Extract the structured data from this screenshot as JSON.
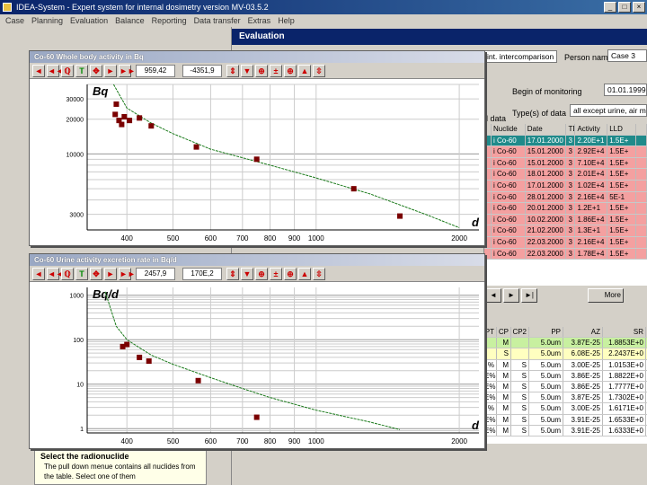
{
  "app": {
    "title": "IDEA-System - Expert system for internal dosimetry version MV-03.5.2",
    "menu": [
      "Case",
      "Planning",
      "Evaluation",
      "Balance",
      "Reporting",
      "Data transfer",
      "Extras",
      "Help"
    ]
  },
  "evaluation": {
    "header": "Evaluation",
    "field_top": "int. intercomparison",
    "person_label": "Person name",
    "person_value": "Case 3",
    "begin_label": "Begin of monitoring",
    "begin_value": "01.01.1999",
    "types_label": "Type(s) of data",
    "types_value": "all except urine, air monitoring",
    "data_label": "l data"
  },
  "measurements": {
    "headers": [
      "",
      "Nuclide",
      "Date",
      "TD",
      "Activity",
      "LLD",
      ""
    ],
    "rows": [
      {
        "style": "teal",
        "cells": [
          "",
          "i Co-60",
          "17.01.2000",
          "3",
          "2.20E+1",
          "1.5E+",
          ""
        ]
      },
      {
        "style": "pink",
        "cells": [
          "",
          "i Co-60",
          "15.01.2000",
          "3",
          "2.92E+4",
          "1.5E+",
          ""
        ]
      },
      {
        "style": "pink",
        "cells": [
          "",
          "i Co-60",
          "15.01.2000",
          "3",
          "7.10E+4",
          "1.5E+",
          ""
        ]
      },
      {
        "style": "pink",
        "cells": [
          "",
          "i Co-60",
          "18.01.2000",
          "3",
          "2.01E+4",
          "1.5E+",
          ""
        ]
      },
      {
        "style": "pink",
        "cells": [
          "",
          "i Co-60",
          "17.01.2000",
          "3",
          "1.02E+4",
          "1.5E+",
          ""
        ]
      },
      {
        "style": "pink",
        "cells": [
          "",
          "i Co-60",
          "28.01.2000",
          "3",
          "2.16E+4",
          "5E-1",
          ""
        ]
      },
      {
        "style": "pink",
        "cells": [
          "",
          "i Co-60",
          "20.01.2000",
          "3",
          "1.2E+1",
          "1.5E+",
          ""
        ]
      },
      {
        "style": "pink",
        "cells": [
          "",
          "i Co-60",
          "10.02.2000",
          "3",
          "1.86E+4",
          "1.5E+",
          ""
        ]
      },
      {
        "style": "pink",
        "cells": [
          "",
          "i Co-60",
          "21.02.2000",
          "3",
          "1.3E+1",
          "1.5E+",
          ""
        ]
      },
      {
        "style": "pink",
        "cells": [
          "",
          "i Co-60",
          "22.03.2000",
          "3",
          "2.16E+4",
          "1.5E+",
          ""
        ]
      },
      {
        "style": "pink",
        "cells": [
          "",
          "i Co-60",
          "22.03.2000",
          "3",
          "1.78E+4",
          "1.5E+",
          ""
        ]
      }
    ],
    "more_button": "More"
  },
  "parameters": {
    "headers": [
      "PT",
      "CP",
      "CP2",
      "PP",
      "AZ",
      "SR"
    ],
    "rows": [
      {
        "style": "green",
        "cells": [
          "",
          "M",
          "",
          "5.0um",
          "3.87E-25",
          "1.8853E+0"
        ]
      },
      {
        "style": "yellow",
        "cells": [
          "",
          "S",
          "",
          "5.0um",
          "6.08E-25",
          "2.2437E+0"
        ]
      },
      {
        "style": "",
        "cells": [
          "%",
          "M",
          "S",
          "5.0um",
          "3.00E-25",
          "1.0153E+0"
        ]
      },
      {
        "style": "",
        "cells": [
          "E%",
          "M",
          "S",
          "5.0um",
          "3.86E-25",
          "1.8822E+0"
        ]
      },
      {
        "style": "",
        "cells": [
          "E%",
          "M",
          "S",
          "5.0um",
          "3.86E-25",
          "1.7777E+0"
        ]
      },
      {
        "style": "",
        "cells": [
          "E%",
          "M",
          "S",
          "5.0um",
          "3.87E-25",
          "1.7302E+0"
        ]
      },
      {
        "style": "",
        "cells": [
          "%",
          "M",
          "S",
          "5.0um",
          "3.00E-25",
          "1.6171E+0"
        ]
      },
      {
        "style": "",
        "cells": [
          "E%",
          "M",
          "S",
          "5.0um",
          "3.91E-25",
          "1.6533E+0"
        ]
      },
      {
        "style": "",
        "cells": [
          "E%",
          "M",
          "S",
          "5.0um",
          "3.91E-25",
          "1.6333E+0"
        ]
      }
    ]
  },
  "help": {
    "title": "Select the radionuclide",
    "text": "The pull down menue contains all nuclides from the table. Select one of them"
  },
  "chart1": {
    "window_title": "Co-60  Whole body activity in Bq",
    "value1": "959,42",
    "value2": "-4351,9"
  },
  "chart2": {
    "window_title": "Co-60  Urine activity excretion rate in Bq/d",
    "value1": "2457,9",
    "value2": "170E,2"
  },
  "chart_data": [
    {
      "type": "scatter",
      "title": "Co-60 Whole body activity in Bq",
      "ylabel": "Bq",
      "xlabel": "d",
      "xscale": "log",
      "yscale": "log",
      "xlim": [
        330,
        2200
      ],
      "ylim": [
        2200,
        40000
      ],
      "x_ticks": [
        "400",
        "500",
        "600",
        "700",
        "800",
        "900",
        "1000",
        "2000"
      ],
      "y_ticks": [
        "30000",
        "20000",
        "10000",
        "3000"
      ],
      "grid": true,
      "series": [
        {
          "points": [
            [
              380,
              27000
            ],
            [
              378,
              22000
            ],
            [
              385,
              19500
            ],
            [
              390,
              18000
            ],
            [
              395,
              21000
            ],
            [
              405,
              19500
            ],
            [
              425,
              20500
            ],
            [
              450,
              17500
            ],
            [
              560,
              11500
            ],
            [
              750,
              9000
            ],
            [
              1200,
              5000
            ],
            [
              1500,
              2900
            ]
          ]
        },
        {
          "line": [
            [
              375,
              40000
            ],
            [
              400,
              25000
            ],
            [
              450,
              18500
            ],
            [
              500,
              15000
            ],
            [
              600,
              11000
            ],
            [
              800,
              8000
            ],
            [
              1000,
              6200
            ],
            [
              1300,
              4500
            ],
            [
              1700,
              3000
            ],
            [
              2000,
              2300
            ]
          ]
        }
      ]
    },
    {
      "type": "scatter",
      "title": "Co-60 Urine activity excretion rate in Bq/d",
      "ylabel": "Bq/d",
      "xlabel": "d",
      "xscale": "log",
      "yscale": "log",
      "xlim": [
        330,
        2200
      ],
      "ylim": [
        0.8,
        1500
      ],
      "x_ticks": [
        "400",
        "500",
        "600",
        "700",
        "800",
        "900",
        "1000",
        "2000"
      ],
      "y_ticks": [
        "1000",
        "100",
        "10",
        "1"
      ],
      "grid": true,
      "series": [
        {
          "points": [
            [
              392,
              70
            ],
            [
              400,
              78
            ],
            [
              425,
              40
            ],
            [
              445,
              33
            ],
            [
              565,
              12
            ],
            [
              750,
              1.8
            ]
          ]
        },
        {
          "line": [
            [
              360,
              1200
            ],
            [
              380,
              200
            ],
            [
              400,
              100
            ],
            [
              450,
              45
            ],
            [
              500,
              28
            ],
            [
              600,
              14
            ],
            [
              700,
              8
            ],
            [
              800,
              5
            ],
            [
              1000,
              2.6
            ],
            [
              1300,
              1.4
            ],
            [
              1500,
              0.95
            ]
          ]
        }
      ]
    }
  ]
}
